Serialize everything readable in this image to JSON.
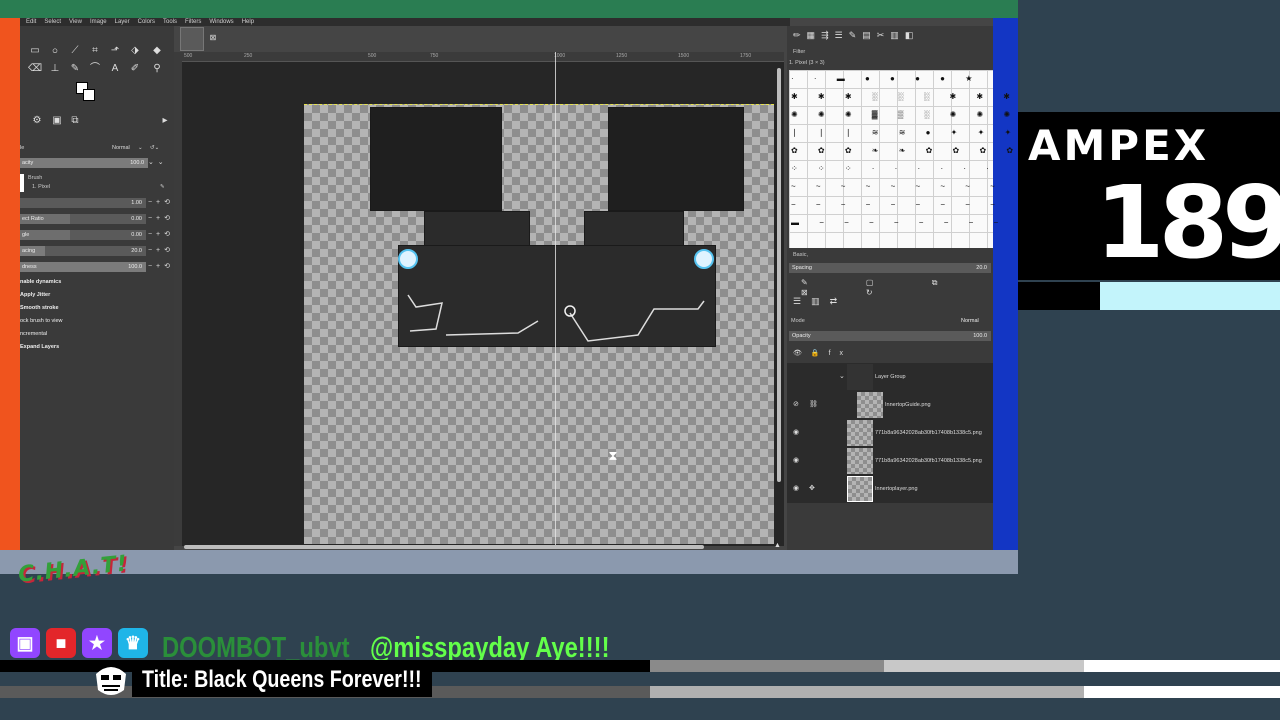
{
  "menubar": {
    "items": [
      "Edit",
      "Select",
      "View",
      "Image",
      "Layer",
      "Colors",
      "Tools",
      "Filters",
      "Windows",
      "Help"
    ]
  },
  "tool_options": {
    "mode_value": "Normal",
    "opacity_label": "acity",
    "opacity_value": "100.0",
    "brush_label": "Brush",
    "brush_value": "1. Pixel",
    "size_value": "1.00",
    "aspect_label": "ect Ratio",
    "aspect_value": "0.00",
    "angle_label": "gle",
    "angle_value": "0.00",
    "spacing_label": "acing",
    "spacing_value": "20.0",
    "hardness_label": "dness",
    "hardness_value": "100.0",
    "enable_dynamics": "nable dynamics",
    "apply_jitter": "Apply Jitter",
    "smooth_stroke": "Smooth stroke",
    "lock_brush": "ock brush to view",
    "incremental": "ncremental",
    "expand_layers": "Expand Layers"
  },
  "ruler": {
    "ticks": [
      "500",
      "250",
      "500",
      "750",
      "1000",
      "1250",
      "1500",
      "1750"
    ]
  },
  "brushes": {
    "filter_placeholder": "Filter",
    "selected_label": "1. Pixel (3 × 3)",
    "tag_value": "Basic,",
    "spacing_label": "Spacing",
    "spacing_value": "20.0"
  },
  "layers": {
    "mode_label": "Mode",
    "mode_value": "Normal",
    "opacity_label": "Opacity",
    "opacity_value": "100.0",
    "rows": [
      {
        "name": "Layer Group"
      },
      {
        "name": "InnertopGuide.png"
      },
      {
        "name": "771b8a96342028ab30fb17408b1338c5.png"
      },
      {
        "name": "771b8a96342028ab30fb17408b1338c5.png"
      },
      {
        "name": "Innertoplayer.png"
      }
    ]
  },
  "ampex": {
    "word": "AMPEX",
    "number": "189"
  },
  "chat": {
    "logo": "C.H.A.T!",
    "username": "DOOMBOT_ubvt",
    "message": "@misspayday Aye!!!!"
  },
  "stream_title": "Title: Black Queens Forever!!!",
  "colors": {
    "top_bar": "#2a7d52",
    "left_strip": "#f0541e",
    "right_strip": "#1336c4",
    "username": "#2a8f3a",
    "message": "#63ff4a",
    "ampex_accent": "#c3f4fb"
  }
}
